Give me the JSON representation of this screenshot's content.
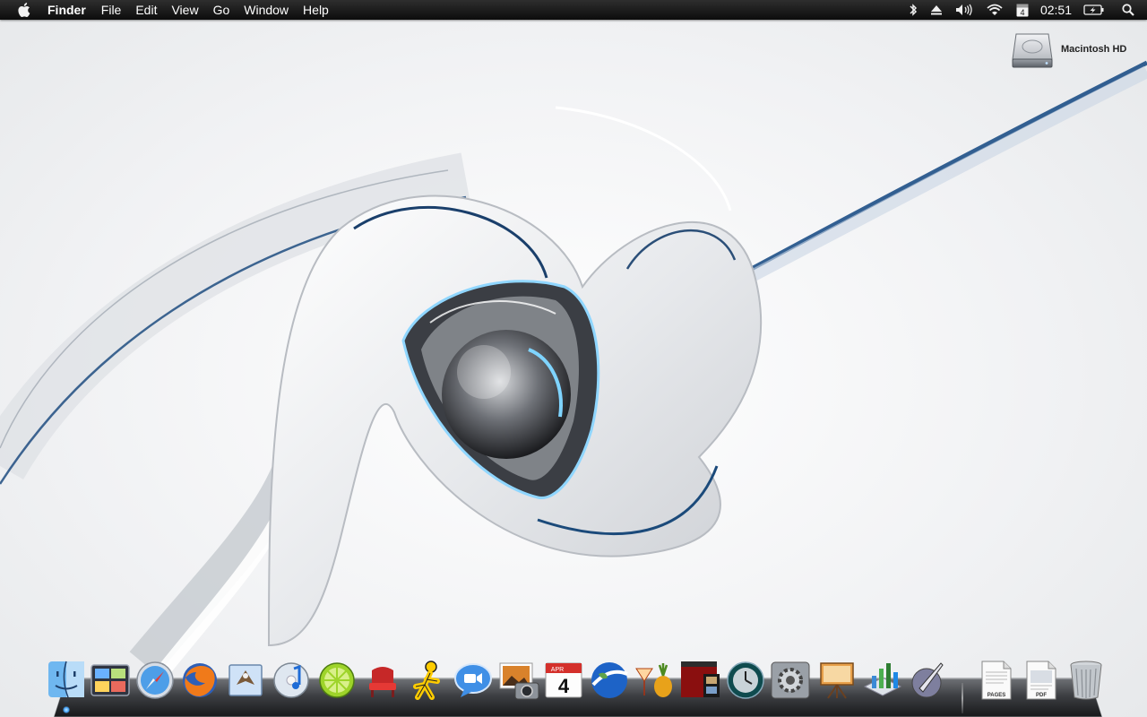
{
  "menubar": {
    "apple_icon": "apple-logo-icon",
    "app_name": "Finder",
    "menus": [
      "File",
      "Edit",
      "View",
      "Go",
      "Window",
      "Help"
    ],
    "status": {
      "bluetooth_icon": "bluetooth-icon",
      "eject_icon": "eject-icon",
      "volume_icon": "volume-icon",
      "wifi_icon": "wifi-icon",
      "calendar_day": "4",
      "clock": "02:51",
      "battery_icon": "battery-charging-icon",
      "spotlight_icon": "spotlight-search-icon"
    }
  },
  "desktop": {
    "icons": [
      {
        "label": "Macintosh HD",
        "icon": "hard-drive-icon"
      }
    ]
  },
  "dock": {
    "apps": [
      {
        "name": "Finder",
        "icon": "finder-icon",
        "running": true
      },
      {
        "name": "Dashboard",
        "icon": "dashboard-icon"
      },
      {
        "name": "Safari",
        "icon": "safari-icon"
      },
      {
        "name": "Firefox",
        "icon": "firefox-icon"
      },
      {
        "name": "Mail",
        "icon": "mail-icon"
      },
      {
        "name": "iTunes",
        "icon": "itunes-icon"
      },
      {
        "name": "LimeWire",
        "icon": "limewire-icon"
      },
      {
        "name": "Front Row",
        "icon": "front-row-icon"
      },
      {
        "name": "AIM",
        "icon": "aim-icon"
      },
      {
        "name": "iChat",
        "icon": "ichat-icon"
      },
      {
        "name": "iPhoto",
        "icon": "iphoto-icon"
      },
      {
        "name": "iCal",
        "icon": "ical-icon",
        "month": "APR",
        "day": "4"
      },
      {
        "name": "Google Earth",
        "icon": "google-earth-icon"
      },
      {
        "name": "Adium",
        "icon": "cocktail-icon"
      },
      {
        "name": "iMovie",
        "icon": "imovie-icon"
      },
      {
        "name": "Time Machine",
        "icon": "time-machine-icon"
      },
      {
        "name": "System Preferences",
        "icon": "system-preferences-icon"
      },
      {
        "name": "Keynote",
        "icon": "keynote-icon"
      },
      {
        "name": "Numbers",
        "icon": "numbers-icon"
      },
      {
        "name": "Script Editor",
        "icon": "script-editor-icon"
      }
    ],
    "stacks": [
      {
        "name": "Pages document",
        "icon": "pages-document-icon",
        "label": "PAGES"
      },
      {
        "name": "PDF document",
        "icon": "pdf-document-icon",
        "label": "PDF"
      }
    ],
    "trash": {
      "name": "Trash",
      "icon": "trash-icon"
    }
  },
  "colors": {
    "menubar": "#111111",
    "wallpaper_accent": "#1b4a7a",
    "dock_indicator": "#4aa9ff"
  }
}
